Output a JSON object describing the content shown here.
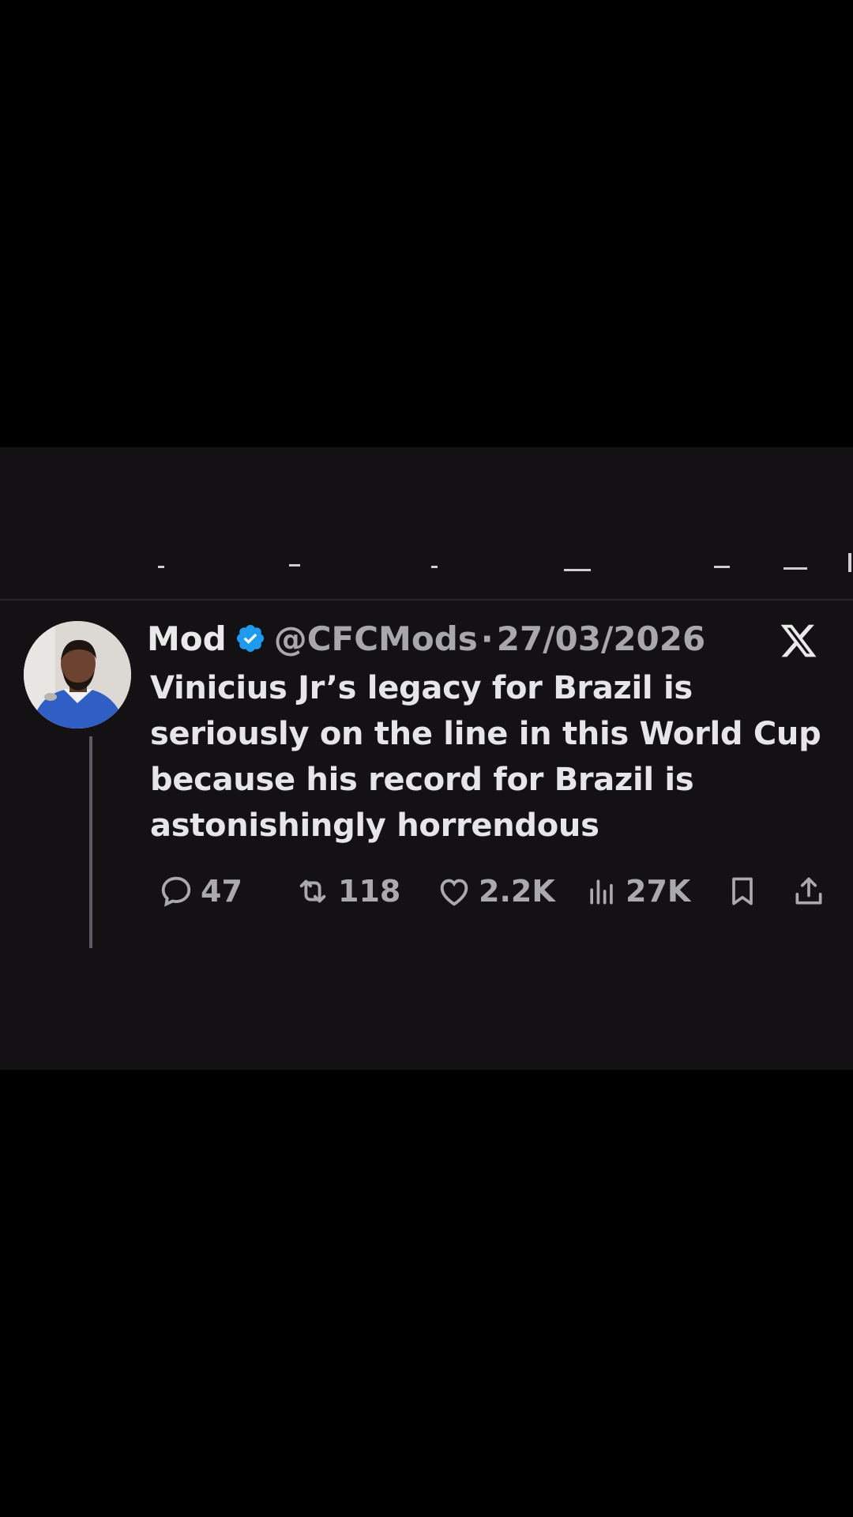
{
  "tweet": {
    "display_name": "Mod",
    "handle": "@CFCMods",
    "separator": "·",
    "date": "27/03/2026",
    "text": "Vinicius Jr’s legacy for Brazil is seriously on the line in this World Cup because his record for Brazil is astonishingly horrendous",
    "verified": true,
    "icons": {
      "verified": "verified-badge-icon",
      "platform": "x-logo-icon"
    }
  },
  "actions": {
    "replies": "47",
    "reposts": "118",
    "likes": "2.2K",
    "views": "27K"
  },
  "colors": {
    "background": "#000000",
    "panel": "#141114",
    "primary_text": "#e9e9ea",
    "secondary_text": "#a7a7ac",
    "verified_blue": "#1d9bf0"
  }
}
